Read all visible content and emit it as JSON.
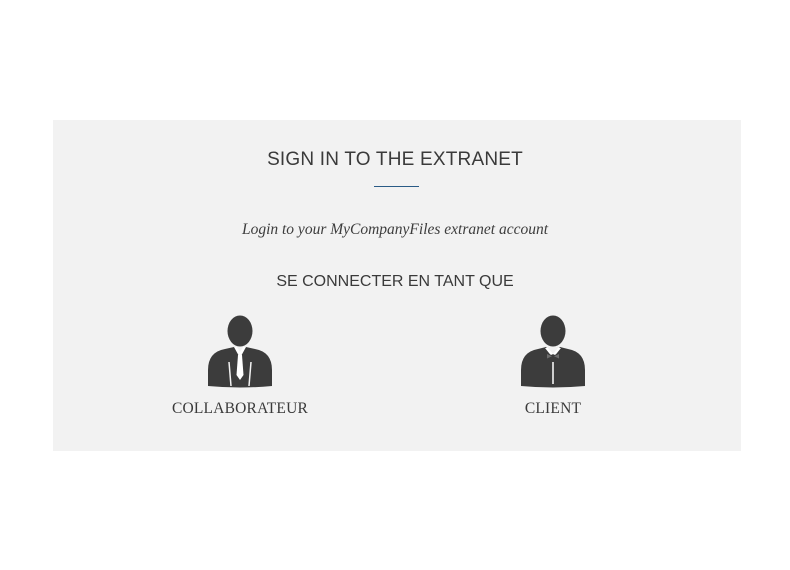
{
  "login": {
    "title": "SIGN IN TO THE EXTRANET",
    "subtitle": "Login to your MyCompanyFiles extranet account",
    "connect_as": "SE CONNECTER EN TANT QUE",
    "options": [
      {
        "label": "COLLABORATEUR",
        "icon": "employee-tie-icon"
      },
      {
        "label": "CLIENT",
        "icon": "client-bowtie-icon"
      }
    ]
  },
  "colors": {
    "panel_background": "#f2f2f2",
    "accent_rule": "#2a5b86",
    "icon": "#3c3c3c",
    "text": "#3a3a3a"
  }
}
